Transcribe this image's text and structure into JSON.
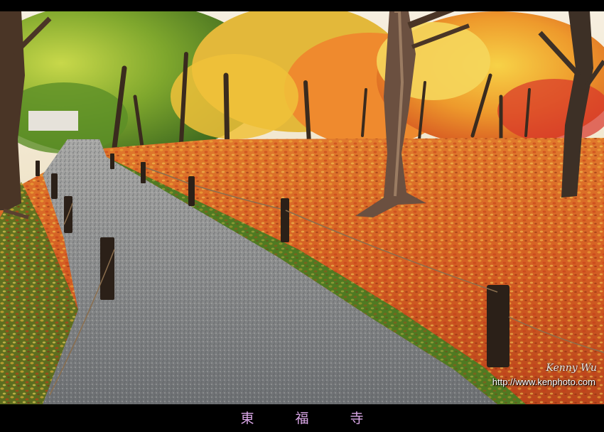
{
  "photo": {
    "description_alt": "autumn garden path",
    "signature": "Kenny Wu",
    "watermark_url": "http://www.kenphoto.com"
  },
  "caption": {
    "title": "東 福 寺",
    "color": "#d9a6e6"
  },
  "colors": {
    "frame": "#000000",
    "leaves_orange": "#e8702a",
    "leaves_yellow": "#f2c230",
    "moss_green": "#4f7a22",
    "gravel_gray": "#8a8d90"
  }
}
